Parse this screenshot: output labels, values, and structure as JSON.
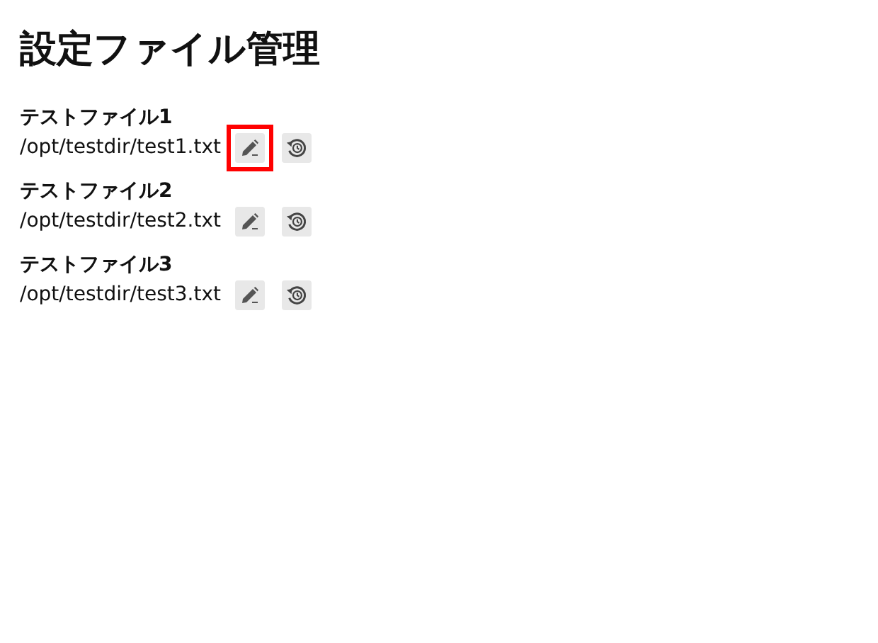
{
  "title": "設定ファイル管理",
  "files": [
    {
      "name": "テストファイル1",
      "path": "/opt/testdir/test1.txt",
      "edit_highlighted": true
    },
    {
      "name": "テストファイル2",
      "path": "/opt/testdir/test2.txt",
      "edit_highlighted": false
    },
    {
      "name": "テストファイル3",
      "path": "/opt/testdir/test3.txt",
      "edit_highlighted": false
    }
  ]
}
